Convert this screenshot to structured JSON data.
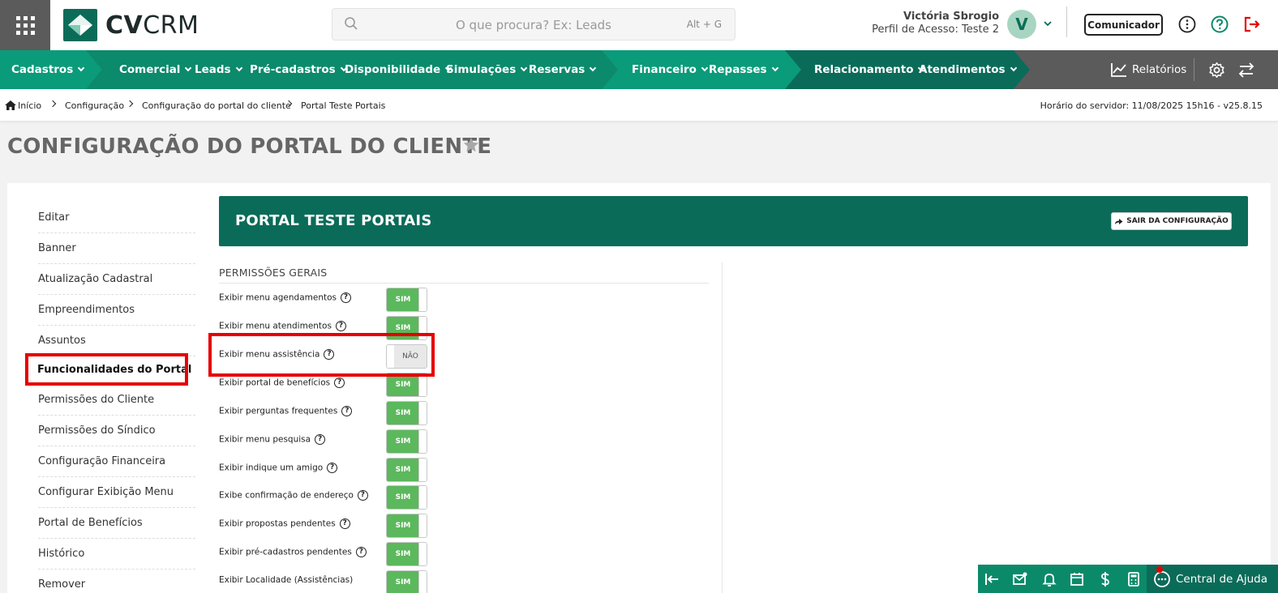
{
  "app": {
    "brand_bold": "CV",
    "brand_light": "CRM"
  },
  "search": {
    "placeholder": "O que procura? Ex: Leads",
    "shortcut": "Alt + G"
  },
  "user": {
    "name": "Victória Sbrogio",
    "profile": "Perfil de Acesso: Teste 2",
    "avatar_letter": "V"
  },
  "header_actions": {
    "communicator": "Comunicador"
  },
  "nav": {
    "items": [
      {
        "label": "Cadastros"
      },
      {
        "label": "Comercial"
      },
      {
        "label": "Leads"
      },
      {
        "label": "Pré-cadastros"
      },
      {
        "label": "Disponibilidade"
      },
      {
        "label": "Simulações"
      },
      {
        "label": "Reservas"
      },
      {
        "label": "Financeiro"
      },
      {
        "label": "Repasses"
      },
      {
        "label": "Relacionamento"
      },
      {
        "label": "Atendimentos"
      }
    ],
    "reports": "Relatórios"
  },
  "breadcrumb": {
    "items": [
      "Início",
      "Configuração",
      "Configuração do portal do cliente",
      "Portal Teste Portais"
    ],
    "server_time": "Horário do servidor: 11/08/2025 15h16 - v25.8.15"
  },
  "page": {
    "title": "CONFIGURAÇÃO DO PORTAL DO CLIENTE"
  },
  "sidebar": {
    "items": [
      {
        "label": "Editar"
      },
      {
        "label": "Banner"
      },
      {
        "label": "Atualização Cadastral"
      },
      {
        "label": "Empreendimentos"
      },
      {
        "label": "Assuntos"
      },
      {
        "label": "Funcionalidades do Portal",
        "active": true
      },
      {
        "label": "Permissões do Cliente"
      },
      {
        "label": "Permissões do Síndico"
      },
      {
        "label": "Configuração Financeira"
      },
      {
        "label": "Configurar Exibição Menu"
      },
      {
        "label": "Portal de Benefícios"
      },
      {
        "label": "Histórico"
      },
      {
        "label": "Remover"
      }
    ]
  },
  "panel": {
    "title": "PORTAL TESTE PORTAIS",
    "exit_button": "SAIR DA CONFIGURAÇÃO",
    "section": "PERMISSÕES GERAIS",
    "permissions": [
      {
        "label": "Exibir menu agendamentos",
        "value": "SIM"
      },
      {
        "label": "Exibir menu atendimentos",
        "value": "SIM"
      },
      {
        "label": "Exibir menu assistência",
        "value": "NÃO"
      },
      {
        "label": "Exibir portal de benefícios",
        "value": "SIM"
      },
      {
        "label": "Exibir perguntas frequentes",
        "value": "SIM"
      },
      {
        "label": "Exibir menu pesquisa",
        "value": "SIM"
      },
      {
        "label": "Exibir indique um amigo",
        "value": "SIM"
      },
      {
        "label": "Exibe confirmação de endereço",
        "value": "SIM"
      },
      {
        "label": "Exibir propostas pendentes",
        "value": "SIM"
      },
      {
        "label": "Exibir pré-cadastros pendentes",
        "value": "SIM"
      },
      {
        "label": "Exibir Localidade (Assistências)",
        "value": "SIM"
      }
    ]
  },
  "help": {
    "label": "Central de Ajuda"
  },
  "colors": {
    "brand_green": "#0b6b59",
    "nav_green": "#0a9b7a",
    "toggle_on": "#5cb85c",
    "highlight": "#e60000",
    "nav_gray": "#5b5b5b"
  }
}
